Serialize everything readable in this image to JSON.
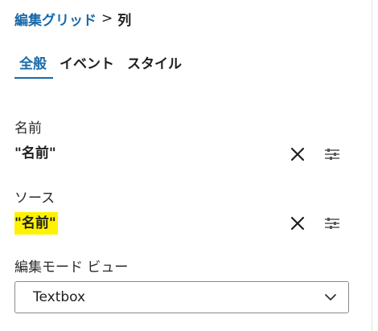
{
  "breadcrumb": {
    "parent": "編集グリッド",
    "separator": ">",
    "current": "列"
  },
  "tabs": [
    {
      "label": "全般",
      "active": true
    },
    {
      "label": "イベント",
      "active": false
    },
    {
      "label": "スタイル",
      "active": false
    }
  ],
  "fields": {
    "name": {
      "label": "名前",
      "value": "\"名前\"",
      "clear_icon": "close-icon",
      "options_icon": "sliders-icon"
    },
    "source": {
      "label": "ソース",
      "value": "\"名前\"",
      "highlighted": true,
      "highlight_color": "#fff200",
      "clear_icon": "close-icon",
      "options_icon": "sliders-icon"
    },
    "edit_mode_view": {
      "label": "編集モード ビュー",
      "selected": "Textbox",
      "dropdown_icon": "chevron-down-icon"
    }
  },
  "colors": {
    "accent": "#1769aa",
    "text": "#1f1f1f",
    "highlight": "#fff200"
  }
}
